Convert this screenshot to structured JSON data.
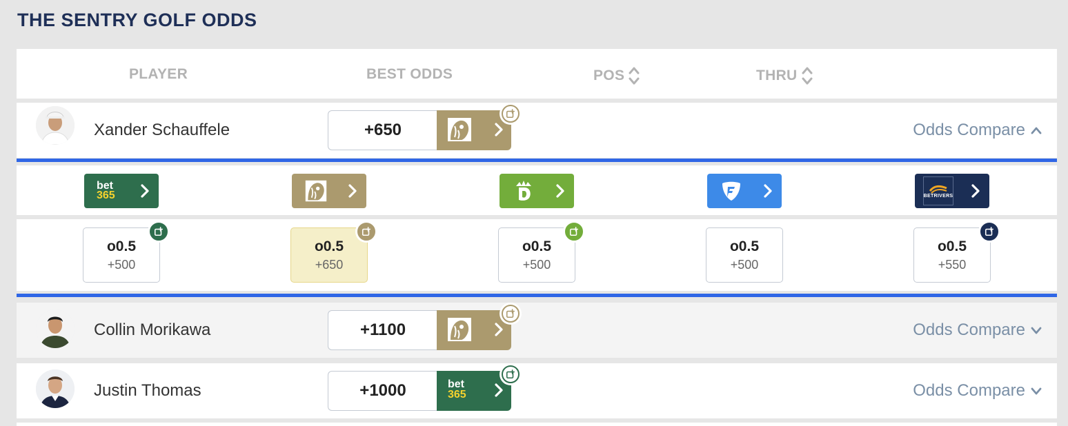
{
  "title": "THE SENTRY GOLF ODDS",
  "columns": {
    "player": "PLAYER",
    "best_odds": "BEST ODDS",
    "pos": "POS",
    "thru": "THRU"
  },
  "colors": {
    "bet365": "#2e6e4d",
    "betmgm": "#ab9a6e",
    "draftkings": "#73ad3b",
    "fanduel": "#3d8ae8",
    "betrivers": "#1b2e55",
    "accent_blue": "#2f66e6",
    "title": "#1e2f57"
  },
  "players": [
    {
      "name": "Xander Schauffele",
      "best_odds": "+650",
      "book": "betmgm",
      "compare_label": "Odds Compare",
      "expanded": true
    },
    {
      "name": "Collin Morikawa",
      "best_odds": "+1100",
      "book": "betmgm",
      "compare_label": "Odds Compare",
      "expanded": false
    },
    {
      "name": "Justin Thomas",
      "best_odds": "+1000",
      "book": "bet365",
      "compare_label": "Odds Compare",
      "expanded": false
    }
  ],
  "expanded_books": [
    {
      "book": "bet365",
      "logo_text_top": "bet",
      "logo_text_bottom": "365",
      "line": "o0.5",
      "odds": "+500",
      "best": false
    },
    {
      "book": "betmgm",
      "line": "o0.5",
      "odds": "+650",
      "best": true
    },
    {
      "book": "draftkings",
      "line": "o0.5",
      "odds": "+500",
      "best": false
    },
    {
      "book": "fanduel",
      "line": "o0.5",
      "odds": "+500",
      "best": false
    },
    {
      "book": "betrivers",
      "logo_text": "BETRIVERS",
      "line": "o0.5",
      "odds": "+550",
      "best": false
    }
  ]
}
